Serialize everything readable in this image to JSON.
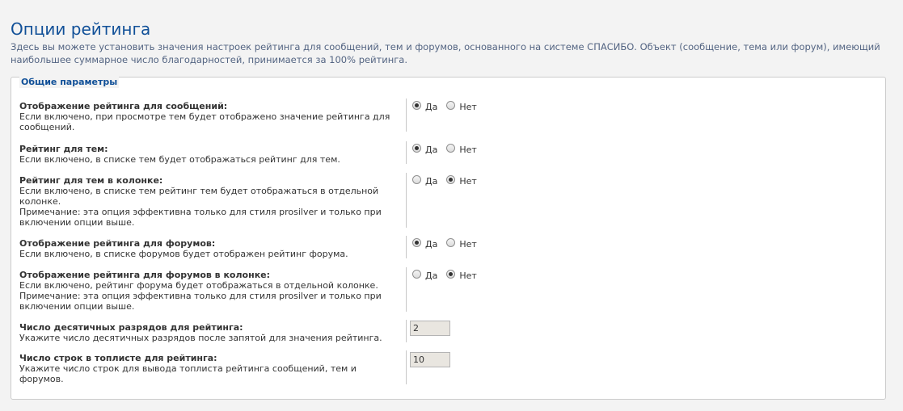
{
  "page": {
    "title": "Опции рейтинга",
    "intro": "Здесь вы можете установить значения настроек рейтинга для сообщений, тем и форумов, основанного на системе СПАСИБО. Объект (сообщение, тема или форум), имеющий наибольшее суммарное число благодарностей, принимается за 100% рейтинга."
  },
  "fieldset": {
    "legend": "Общие параметры"
  },
  "options": [
    {
      "title": "Отображение рейтинга для сообщений:",
      "desc": "Если включено, при просмотре тем будет отображено значение рейтинга для сообщений.",
      "yes": "Да",
      "no": "Нет",
      "selected": "yes"
    },
    {
      "title": "Рейтинг для тем:",
      "desc": "Если включено, в списке тем будет отображаться рейтинг для тем.",
      "yes": "Да",
      "no": "Нет",
      "selected": "yes"
    },
    {
      "title": "Рейтинг для тем в колонке:",
      "desc": "Если включено, в списке тем рейтинг тем будет отображаться в отдельной колонке.",
      "note": "Примечание: эта опция эффективна только для стиля prosilver и только при включении опции выше.",
      "yes": "Да",
      "no": "Нет",
      "selected": "no"
    },
    {
      "title": "Отображение рейтинга для форумов:",
      "desc": "Если включено, в списке форумов будет отображен рейтинг форума.",
      "yes": "Да",
      "no": "Нет",
      "selected": "yes"
    },
    {
      "title": "Отображение рейтинга для форумов в колонке:",
      "desc": "Если включено, рейтинг форума будет отображаться в отдельной колонке.",
      "note": "Примечание: эта опция эффективна только для стиля prosilver и только при включении опции выше.",
      "yes": "Да",
      "no": "Нет",
      "selected": "no"
    },
    {
      "title": "Число десятичных разрядов для рейтинга:",
      "desc": "Укажите число десятичных разрядов после запятой для значения рейтинга.",
      "value": "2"
    },
    {
      "title": "Число строк в топлисте для рейтинга:",
      "desc": "Укажите число строк для вывода топлиста рейтинга сообщений, тем и форумов.",
      "value": "10"
    }
  ]
}
